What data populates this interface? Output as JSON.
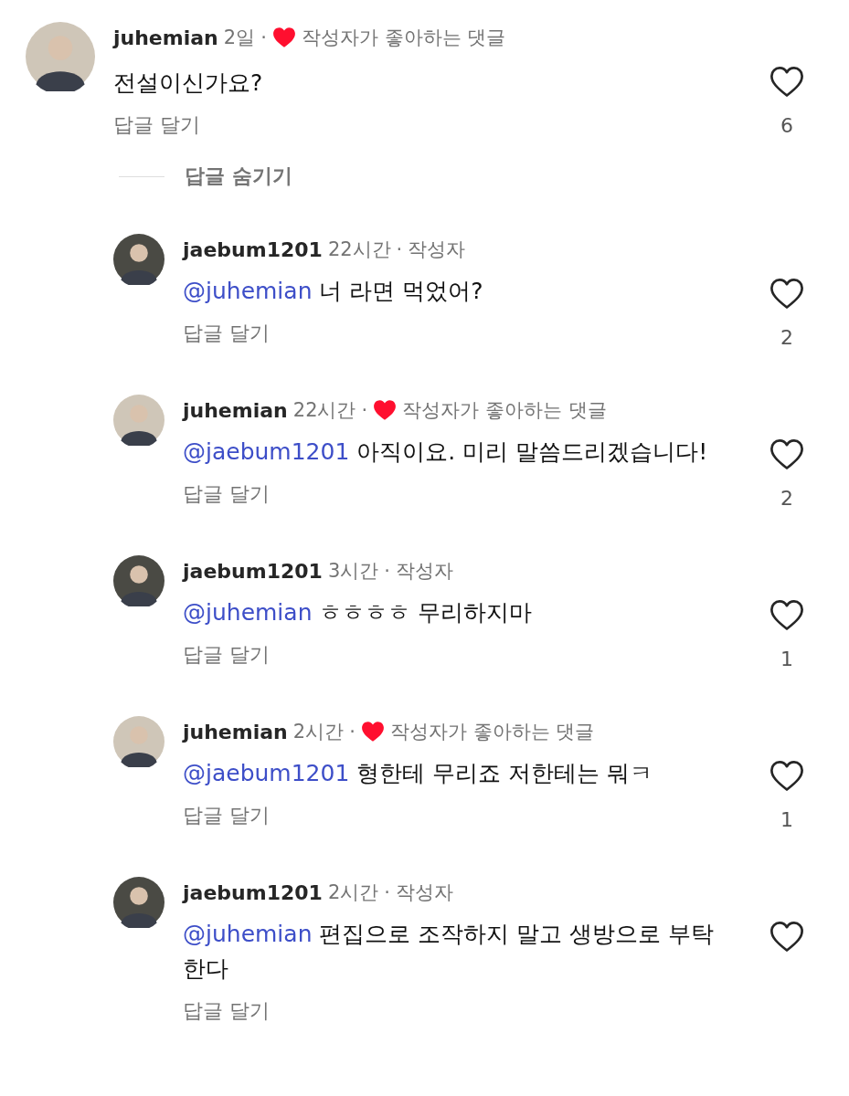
{
  "comment": {
    "author": "juhemian",
    "time": "2일",
    "dot": "·",
    "badge": {
      "kind": "liked",
      "label": "작성자가 좋아하는 댓글"
    },
    "text": "전설이신가요?",
    "reply_label": "답글 달기",
    "liked": false,
    "likes": "6"
  },
  "hide_replies": "답글 숨기기",
  "replies": [
    {
      "author": "jaebum1201",
      "time": "22시간",
      "dot": "·",
      "badge": {
        "kind": "author",
        "label": "작성자"
      },
      "mention": "@juhemian",
      "text": "너 라면 먹었어?",
      "reply_label": "답글 달기",
      "liked": false,
      "likes": "2"
    },
    {
      "author": "juhemian",
      "time": "22시간",
      "dot": "·",
      "badge": {
        "kind": "liked",
        "label": "작성자가 좋아하는 댓글"
      },
      "mention": "@jaebum1201",
      "text": "아직이요. 미리 말씀드리겠습니다!",
      "reply_label": "답글 달기",
      "liked": false,
      "likes": "2"
    },
    {
      "author": "jaebum1201",
      "time": "3시간",
      "dot": "·",
      "badge": {
        "kind": "author",
        "label": "작성자"
      },
      "mention": "@juhemian",
      "text": "ㅎㅎㅎㅎ 무리하지마",
      "reply_label": "답글 달기",
      "liked": false,
      "likes": "1"
    },
    {
      "author": "juhemian",
      "time": "2시간",
      "dot": "·",
      "badge": {
        "kind": "liked",
        "label": "작성자가 좋아하는 댓글"
      },
      "mention": "@jaebum1201",
      "text": "형한테 무리죠 저한테는 뭐ㅋ",
      "reply_label": "답글 달기",
      "liked": false,
      "likes": "1"
    },
    {
      "author": "jaebum1201",
      "time": "2시간",
      "dot": "·",
      "badge": {
        "kind": "author",
        "label": "작성자"
      },
      "mention": "@juhemian",
      "text": "편집으로 조작하지 말고 생방으로 부탁한다",
      "reply_label": "답글 달기",
      "liked": false
    }
  ]
}
